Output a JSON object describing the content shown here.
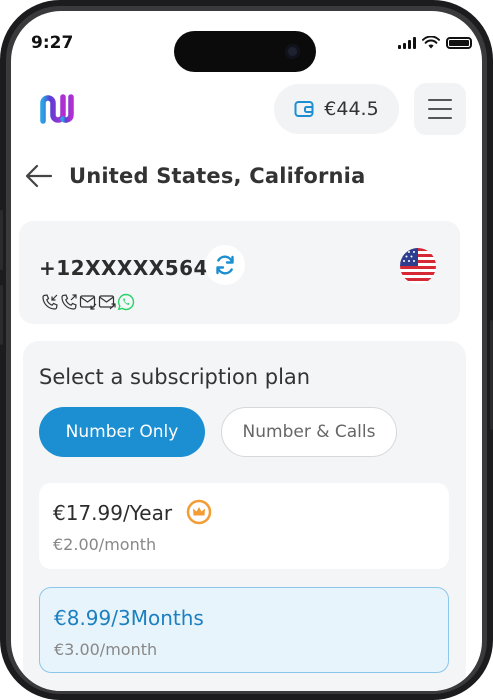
{
  "status_bar": {
    "time": "9:27"
  },
  "header": {
    "wallet_balance": "€44.5"
  },
  "page": {
    "title": "United States, California"
  },
  "number_card": {
    "phone_number": "+12XXXXX564",
    "features": [
      "incoming-call-icon",
      "outgoing-call-icon",
      "incoming-sms-icon",
      "outgoing-sms-icon",
      "whatsapp-icon"
    ],
    "flag": "us-flag-icon"
  },
  "plans": {
    "heading": "Select a subscription plan",
    "tabs": [
      {
        "label": "Number Only",
        "active": true
      },
      {
        "label": "Number & Calls",
        "active": false
      }
    ],
    "items": [
      {
        "price": "€17.99/Year",
        "per_month": "€2.00/month",
        "badge": "crown-icon"
      },
      {
        "price": "€8.99/3Months",
        "per_month": "€3.00/month",
        "selected": true
      }
    ]
  },
  "colors": {
    "accent": "#1b8fd1",
    "badge": "#f39c34",
    "whatsapp": "#25d366"
  }
}
